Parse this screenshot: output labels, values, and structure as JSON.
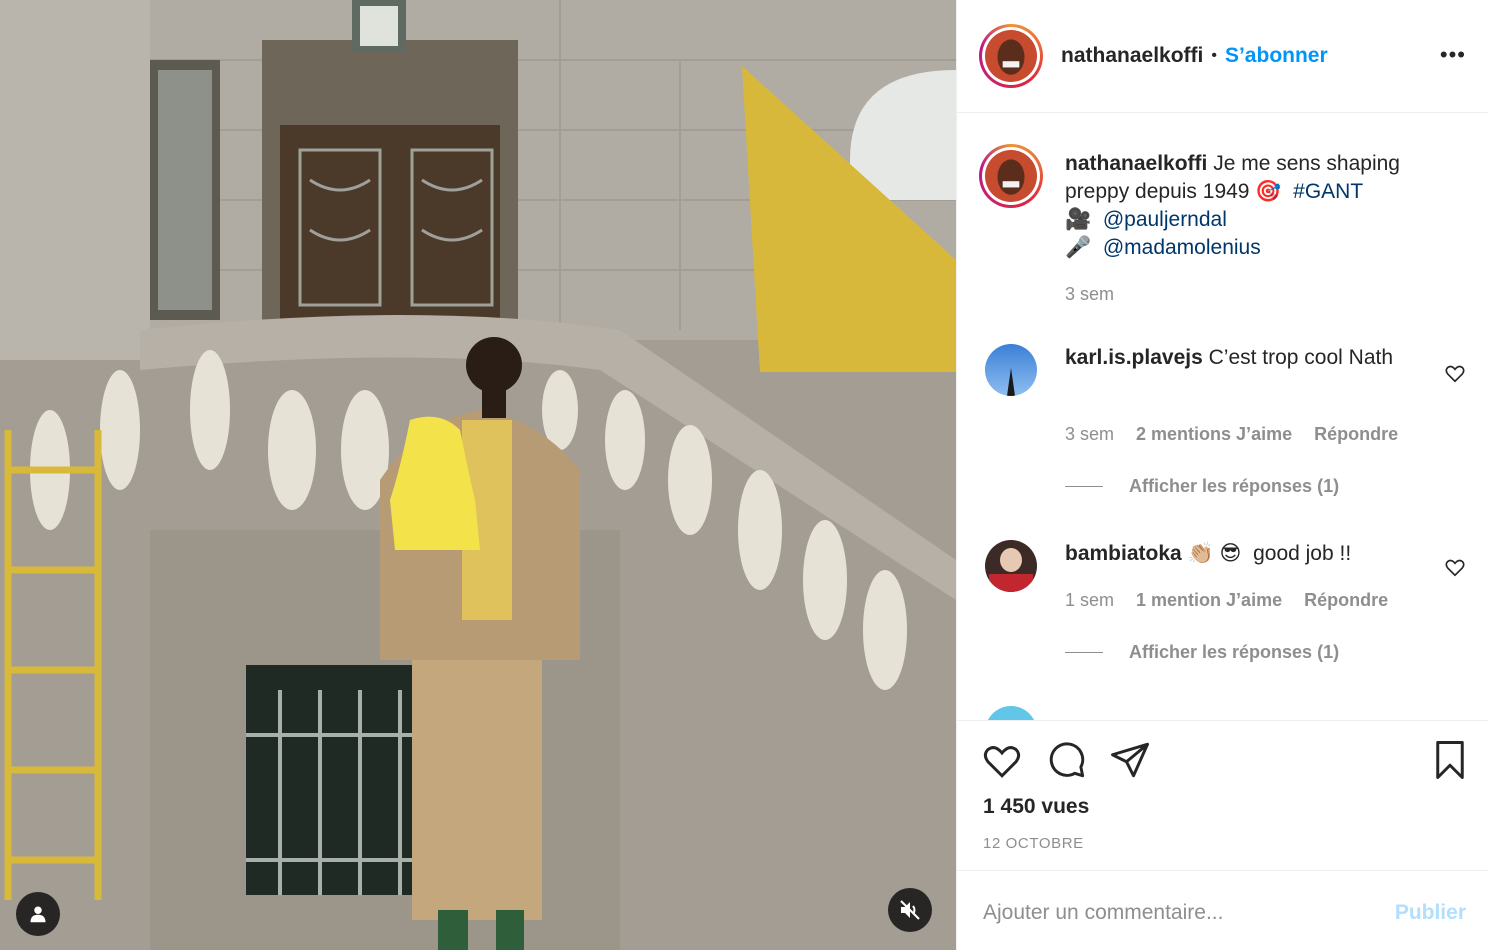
{
  "post": {
    "author": "nathanaelkoffi",
    "separator": "•",
    "follow_label": "S’abonner",
    "more_icon": "more-horizontal-icon",
    "media_type": "video"
  },
  "caption": {
    "user": "nathanaelkoffi",
    "text": "Je me sens shaping preppy depuis 1949",
    "emoji_1": "🎯",
    "hashtag": "#GANT",
    "line2_emoji": "🎥",
    "mention_1": "@pauljerndal",
    "line3_emoji": "🎤",
    "mention_2": "@madamolenius",
    "time": "3 sem"
  },
  "comments": [
    {
      "user": "karl.is.plavejs",
      "text": "C’est trop cool Nath",
      "time": "3 sem",
      "likes": "2 mentions J’aime",
      "reply": "Répondre",
      "view_replies": "Afficher les réponses (1)"
    },
    {
      "user": "bambiatoka",
      "emojis": "👏🏼 😎",
      "text": "good job !!",
      "time": "1 sem",
      "likes": "1 mention J’aime",
      "reply": "Répondre",
      "view_replies": "Afficher les réponses (1)"
    }
  ],
  "stats": {
    "views": "1 450 vues",
    "date": "12 OCTOBRE"
  },
  "composer": {
    "placeholder": "Ajouter un commentaire...",
    "publish_label": "Publier"
  },
  "colors": {
    "accent": "#0095f6",
    "muted": "#8e8e8e",
    "text": "#262626",
    "publish_disabled": "#b2dffc",
    "mention": "#00376b"
  }
}
